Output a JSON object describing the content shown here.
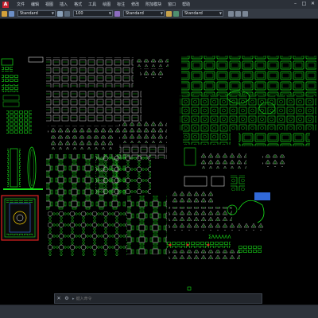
{
  "app": {
    "icon_letter": "A",
    "title": ""
  },
  "menu": [
    {
      "label": "文件"
    },
    {
      "label": "编辑"
    },
    {
      "label": "视图"
    },
    {
      "label": "插入"
    },
    {
      "label": "格式"
    },
    {
      "label": "工具"
    },
    {
      "label": "绘图"
    },
    {
      "label": "标注"
    },
    {
      "label": "修改"
    },
    {
      "label": "附加模块"
    },
    {
      "label": "窗口"
    },
    {
      "label": "帮助"
    }
  ],
  "toolbar": {
    "text_style": "Standard",
    "scale": "100",
    "dim_style": "Standard",
    "table_style": "Standard"
  },
  "command_line": {
    "prompt": "▸",
    "placeholder": "键入命令"
  },
  "colors": {
    "background": "#000000",
    "primary_lines": "#18e018",
    "secondary_lines": "#ffffff",
    "accent_red": "#e02020",
    "accent_blue": "#3a7bff"
  }
}
